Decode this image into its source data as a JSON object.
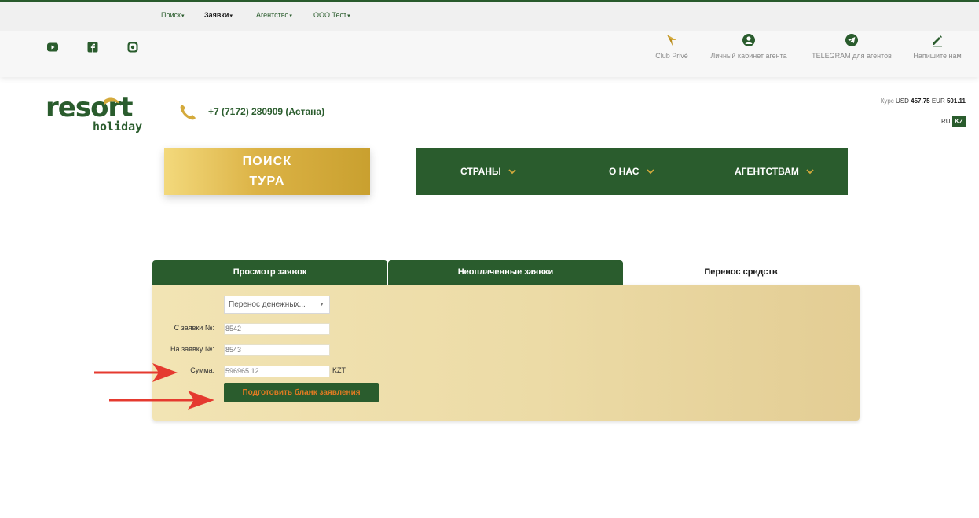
{
  "top_menu": [
    {
      "label": "Поиск",
      "bold": false
    },
    {
      "label": "Заявки",
      "bold": true
    },
    {
      "label": "Агентство",
      "bold": false
    },
    {
      "label": "ООО Тест",
      "bold": false
    }
  ],
  "social": [
    "youtube-icon",
    "facebook-icon",
    "instagram-icon"
  ],
  "quick_links": [
    {
      "label": "Club Privé",
      "icon": "compass-icon"
    },
    {
      "label": "Личный кабинет агента",
      "icon": "user-icon"
    },
    {
      "label": "TELEGRAM для агентов",
      "icon": "telegram-icon"
    },
    {
      "label": "Напишите нам",
      "icon": "pencil-icon"
    }
  ],
  "logo": {
    "line1": "resort",
    "line2": "holiday"
  },
  "phone": "+7 (7172) 280909 (Астана)",
  "rates": {
    "label": "Курс",
    "usd_label": "USD",
    "usd": "457.75",
    "eur_label": "EUR",
    "eur": "501.11"
  },
  "lang": {
    "ru": "RU",
    "kz": "KZ"
  },
  "search_button": "ПОИСК ТУРА",
  "nav": [
    "СТРАНЫ",
    "О НАС",
    "АГЕНТСТВАМ"
  ],
  "tabs": [
    {
      "label": "Просмотр заявок",
      "active": false
    },
    {
      "label": "Неоплаченные заявки",
      "active": false
    },
    {
      "label": "Перенос средств",
      "active": true
    }
  ],
  "form": {
    "operation": "Перенос денежных...",
    "from_label": "С заявки №:",
    "from_value": "8542",
    "to_label": "На заявку №:",
    "to_value": "8543",
    "sum_label": "Сумма:",
    "sum_value": "596965.12",
    "currency": "KZT",
    "submit": "Подготовить бланк заявления"
  },
  "colors": {
    "brand_green": "#2a5c2d",
    "gold": "#d4aa3c",
    "panel": "#eddba6",
    "accent_orange": "#e07a22",
    "arrow_red": "#e53a2f"
  }
}
